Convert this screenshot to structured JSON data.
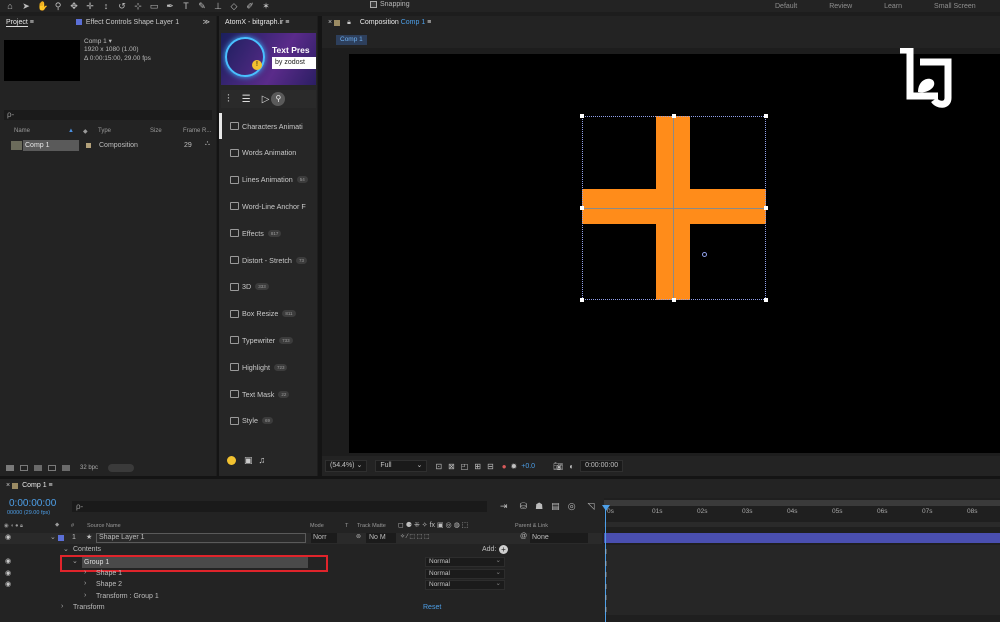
{
  "toolbar": {
    "snapping_label": "Snapping",
    "workspaces": [
      "Default",
      "Review",
      "Learn",
      "Small Screen"
    ]
  },
  "project": {
    "tab_label": "Project",
    "effect_controls_tab": "Effect Controls Shape Layer 1",
    "comp_name": "Comp 1 ▾",
    "comp_size": "1920 x 1080 (1.00)",
    "comp_duration": "Δ 0:00:15:00, 29.00 fps",
    "search_placeholder": "ρ-",
    "columns": {
      "name": "Name",
      "type": "Type",
      "size": "Size",
      "frame_rate": "Frame R..."
    },
    "row": {
      "name": "Comp 1",
      "type": "Composition",
      "frame_rate": "29"
    },
    "bpc": "32 bpc"
  },
  "atomx": {
    "tab_label": "AtomX - bitgraph.ir",
    "banner_title": "Text Pres",
    "banner_sub": "by zodost",
    "items": [
      {
        "label": "Characters Animati",
        "badge": ""
      },
      {
        "label": "Words Animation",
        "badge": ""
      },
      {
        "label": "Lines Animation",
        "badge": "54"
      },
      {
        "label": "Word-Line Anchor F",
        "badge": ""
      },
      {
        "label": "Effects",
        "badge": "817"
      },
      {
        "label": "Distort - Stretch",
        "badge": "73"
      },
      {
        "label": "3D",
        "badge": "333"
      },
      {
        "label": "Box Resize",
        "badge": "811"
      },
      {
        "label": "Typewriter",
        "badge": "733"
      },
      {
        "label": "Highlight",
        "badge": "723"
      },
      {
        "label": "Text Mask",
        "badge": "22"
      },
      {
        "label": "Style",
        "badge": "69"
      }
    ]
  },
  "composition": {
    "tab_label": "Composition",
    "tab_comp": "Comp 1",
    "breadcrumb": "Comp 1",
    "logo_text": "LSJ",
    "shape_color": "#ff8c1a",
    "zoom": "(54.4%)",
    "resolution": "Full",
    "exposure": "+0.0",
    "timecode": "0:00:00:00"
  },
  "timeline": {
    "tab_label": "Comp 1",
    "timecode": "0:00:00:00",
    "fps": "00000 (29.00 fps)",
    "search_placeholder": "ρ-",
    "columns": {
      "num": "#",
      "source_name": "Source Name",
      "mode": "Mode",
      "t": "T",
      "track_matte": "Track Matte",
      "parent": "Parent & Link"
    },
    "layer": {
      "num": "1",
      "name": "Shape Layer 1",
      "mode": "Norr",
      "matte": "No M",
      "parent": "None"
    },
    "contents_label": "Contents",
    "add_label": "Add:",
    "group_label": "Group 1",
    "group_mode": "Normal",
    "shape1_label": "Shape 1",
    "shape1_mode": "Normal",
    "shape2_label": "Shape 2",
    "shape2_mode": "Normal",
    "transform_group_label": "Transform : Group 1",
    "transform_label": "Transform",
    "reset_label": "Reset",
    "ruler": [
      "0s",
      "01s",
      "02s",
      "03s",
      "04s",
      "05s",
      "06s",
      "07s",
      "08s"
    ],
    "highlight_color": "#e0242b",
    "bar_color": "#4a4fb0"
  }
}
